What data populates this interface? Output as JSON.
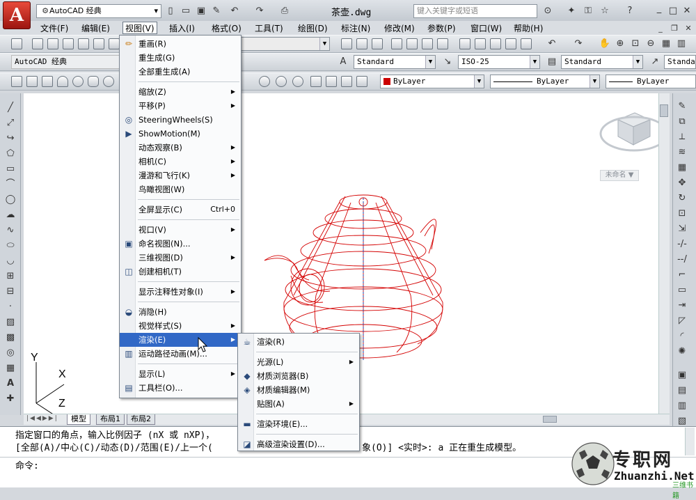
{
  "app": {
    "logo_letter": "A",
    "workspace": "AutoCAD 经典",
    "doc_title": "茶壶.dwg",
    "search_placeholder": "键入关键字或短语"
  },
  "menubar": [
    {
      "label": "文件(F)"
    },
    {
      "label": "编辑(E)"
    },
    {
      "label": "视图(V)",
      "active": true
    },
    {
      "label": "插入(I)"
    },
    {
      "label": "格式(O)"
    },
    {
      "label": "工具(T)"
    },
    {
      "label": "绘图(D)"
    },
    {
      "label": "标注(N)"
    },
    {
      "label": "修改(M)"
    },
    {
      "label": "参数(P)"
    },
    {
      "label": "窗口(W)"
    },
    {
      "label": "帮助(H)"
    }
  ],
  "toolbar": {
    "workspace_combo": "AutoCAD 经典",
    "text_style": "Standard",
    "dim_style": "ISO-25",
    "table_style": "Standard",
    "mleader_style": "Standard",
    "color": "ByLayer",
    "linetype": "ByLayer",
    "lineweight": "ByLayer",
    "color_hex": "#cc0000"
  },
  "view_menu": [
    {
      "label": "重画(R)",
      "icon": "pencil-icon"
    },
    {
      "label": "重生成(G)"
    },
    {
      "label": "全部重生成(A)"
    },
    {
      "sep": true
    },
    {
      "label": "缩放(Z)",
      "submenu": true
    },
    {
      "label": "平移(P)",
      "submenu": true
    },
    {
      "label": "SteeringWheels(S)",
      "icon": "steeringwheel-icon"
    },
    {
      "label": "ShowMotion(M)",
      "icon": "showmotion-icon"
    },
    {
      "label": "动态观察(B)",
      "submenu": true
    },
    {
      "label": "相机(C)",
      "submenu": true
    },
    {
      "label": "漫游和飞行(K)",
      "submenu": true
    },
    {
      "label": "鸟瞰视图(W)"
    },
    {
      "sep": true
    },
    {
      "label": "全屏显示(C)",
      "shortcut": "Ctrl+0"
    },
    {
      "sep": true
    },
    {
      "label": "视口(V)",
      "submenu": true
    },
    {
      "label": "命名视图(N)...",
      "icon": "named-view-icon"
    },
    {
      "label": "三维视图(D)",
      "submenu": true
    },
    {
      "label": "创建相机(T)",
      "icon": "camera-icon"
    },
    {
      "sep": true
    },
    {
      "label": "显示注释性对象(I)",
      "submenu": true
    },
    {
      "sep": true
    },
    {
      "label": "消隐(H)",
      "icon": "hide-icon"
    },
    {
      "label": "视觉样式(S)",
      "submenu": true
    },
    {
      "label": "渲染(E)",
      "submenu": true,
      "highlighted": true
    },
    {
      "label": "运动路径动画(M)...",
      "icon": "motionpath-icon"
    },
    {
      "sep": true
    },
    {
      "label": "显示(L)",
      "submenu": true
    },
    {
      "label": "工具栏(O)...",
      "icon": "toolbar-icon"
    }
  ],
  "render_menu": [
    {
      "label": "渲染(R)",
      "icon": "teapot-icon"
    },
    {
      "sep": true
    },
    {
      "label": "光源(L)",
      "submenu": true
    },
    {
      "label": "材质浏览器(B)",
      "icon": "material-browser-icon"
    },
    {
      "label": "材质编辑器(M)",
      "icon": "material-editor-icon"
    },
    {
      "label": "贴图(A)",
      "submenu": true
    },
    {
      "sep": true
    },
    {
      "label": "渲染环境(E)...",
      "icon": "render-env-icon"
    },
    {
      "sep": true
    },
    {
      "label": "高级渲染设置(D)...",
      "icon": "advanced-render-icon"
    }
  ],
  "viewcube": {
    "label": "未命名 ▼"
  },
  "layout_tabs": [
    {
      "label": "模型",
      "active": true
    },
    {
      "label": "布局1"
    },
    {
      "label": "布局2"
    }
  ],
  "command": {
    "line1": "指定窗口的角点，输入比例因子 (nX 或 nXP)，",
    "line2a": "[全部(A)/中心(C)/动态(D)/范围(E)/上一个(",
    "line2b": "象(O)] <实时>: a 正在重生成模型。",
    "prompt": "命令:"
  },
  "watermark": {
    "brand": "专职网",
    "url": "Zhuanzhi.Net",
    "tag": "三维书籍"
  }
}
